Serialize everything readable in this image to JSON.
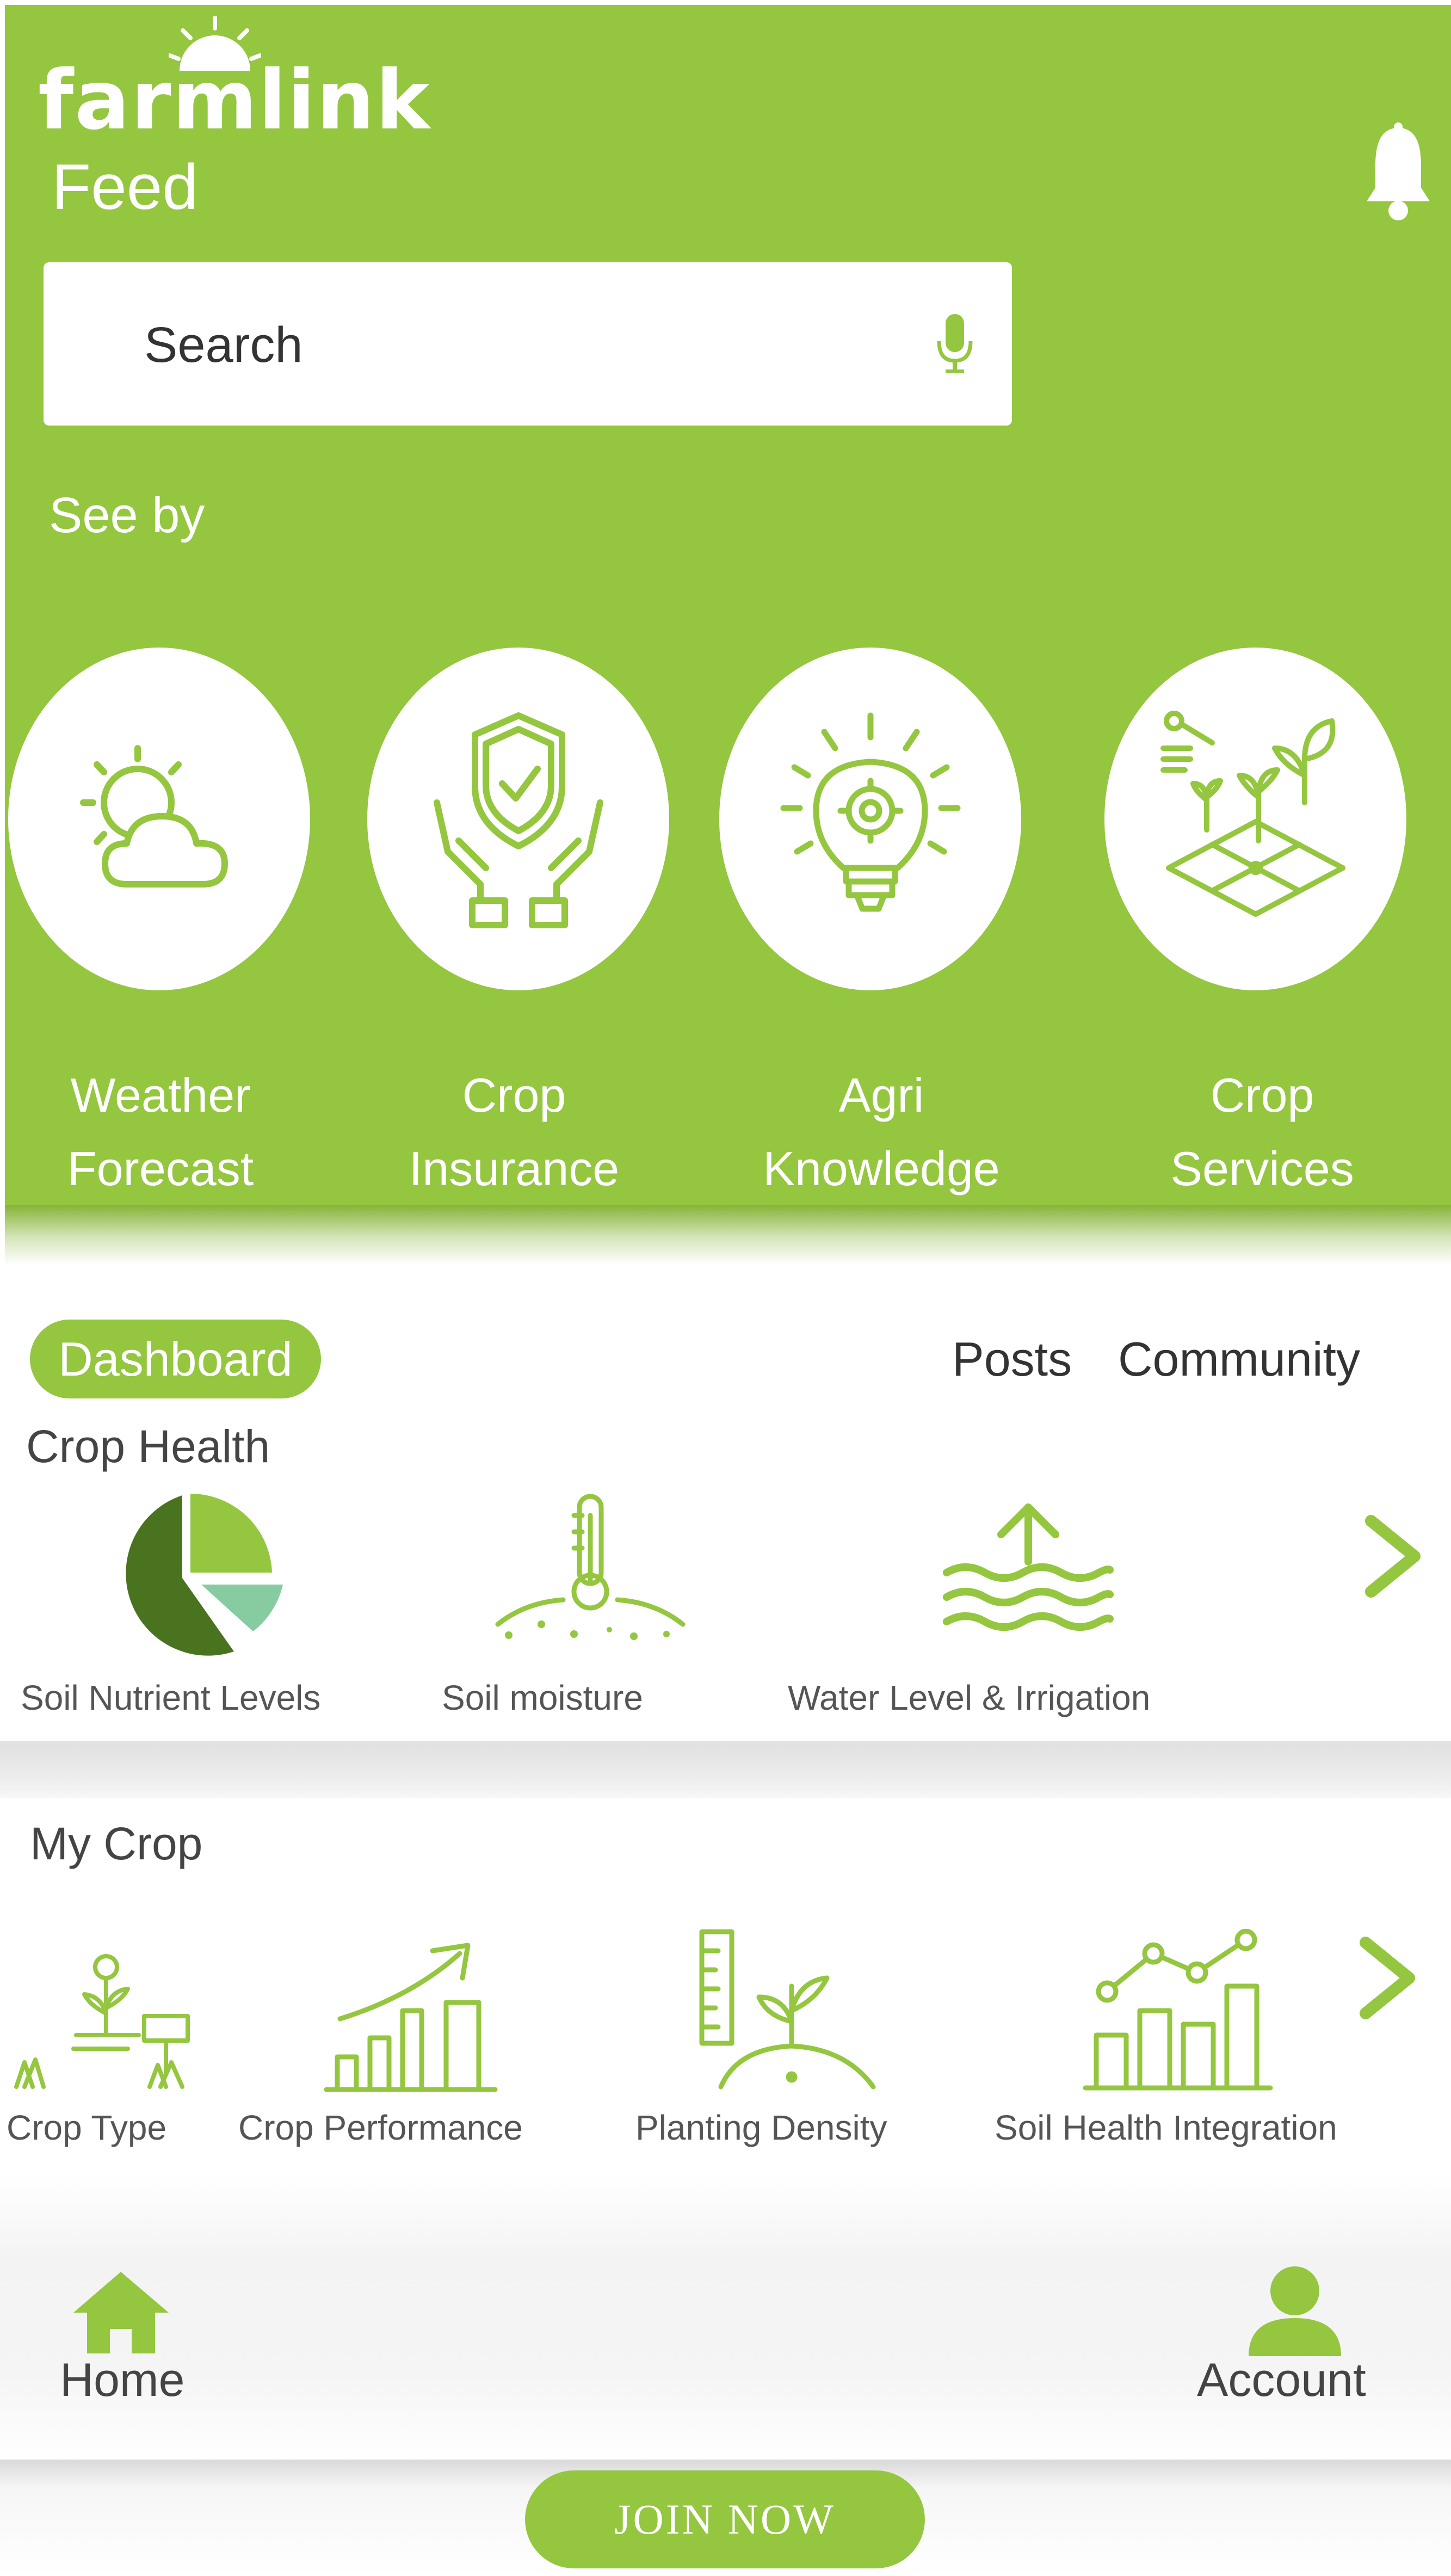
{
  "brand": {
    "logo_text": "farmlink",
    "accent": "#94c63f"
  },
  "header": {
    "title": "Feed",
    "notification_icon": "bell-icon",
    "search": {
      "placeholder": "Search",
      "icon": "mic-icon"
    },
    "see_by_label": "See by",
    "categories": [
      {
        "line1": "Weather",
        "line2": "Forecast",
        "icon": "weather-icon"
      },
      {
        "line1": "Crop",
        "line2": "Insurance",
        "icon": "shield-hands-icon"
      },
      {
        "line1": "Agri",
        "line2": "Knowledge",
        "icon": "lightbulb-gear-icon"
      },
      {
        "line1": "Crop",
        "line2": "Services",
        "icon": "farm-plot-icon"
      }
    ]
  },
  "tabs": {
    "active": "Dashboard",
    "items": [
      "Dashboard",
      "Posts",
      "Community"
    ]
  },
  "crop_health": {
    "title": "Crop Health",
    "items": [
      {
        "label": "Soil Nutrient Levels",
        "icon": "pie-chart-icon"
      },
      {
        "label": "Soil moisture",
        "icon": "soil-thermometer-icon"
      },
      {
        "label": "Water Level & Irrigation",
        "icon": "water-level-icon"
      }
    ],
    "next_icon": "chevron-right-icon"
  },
  "my_crop": {
    "title": "My Crop",
    "items": [
      {
        "label": "Crop Type",
        "icon": "plants-icon"
      },
      {
        "label": "Crop Performance",
        "icon": "growth-chart-icon"
      },
      {
        "label": "Planting Density",
        "icon": "ruler-sprout-icon"
      },
      {
        "label": "Soil Health Integration",
        "icon": "bar-line-chart-icon"
      }
    ],
    "next_icon": "chevron-right-icon"
  },
  "bottom_nav": {
    "home": {
      "label": "Home",
      "icon": "home-icon"
    },
    "account": {
      "label": "Account",
      "icon": "account-icon"
    }
  },
  "cta": {
    "label": "JOIN  NOW"
  }
}
